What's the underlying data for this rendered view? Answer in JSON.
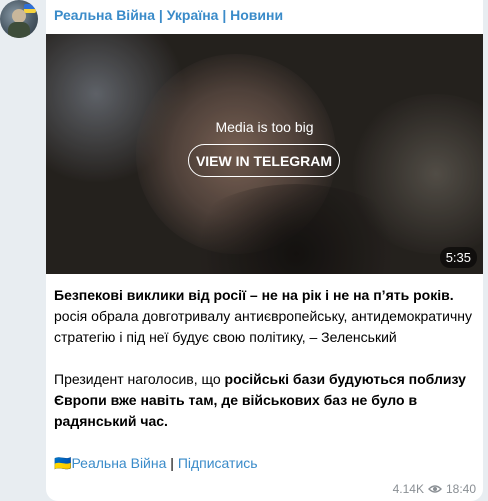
{
  "channel": {
    "name": "Реальна Війна | Україна | Новини"
  },
  "media": {
    "notice": "Media is too big",
    "button_label": "VIEW IN TELEGRAM",
    "duration": "5:35"
  },
  "message": {
    "p1_bold": "Безпекові виклики від росії – не на рік і не на п’ять років.",
    "p1_rest": " росія обрала довготривалу антиєвропейську, антидемократичну стратегію і під неї будує свою політику, – Зеленський",
    "p2_start": "Президент наголосив, що ",
    "p2_bold": "російські бази будуються поблизу Європи вже навіть там, де військових баз не було в радянський час.",
    "flag_emoji": "🇺🇦",
    "link_channel": "Реальна Війна",
    "separator": " | ",
    "link_subscribe": "Підписатись"
  },
  "footer": {
    "views": "4.14K",
    "time": "18:40"
  },
  "colors": {
    "accent": "#3a8bc9",
    "background": "#e8edf1",
    "meta": "#8a8f94"
  },
  "icons": {
    "views": "eye-icon"
  }
}
